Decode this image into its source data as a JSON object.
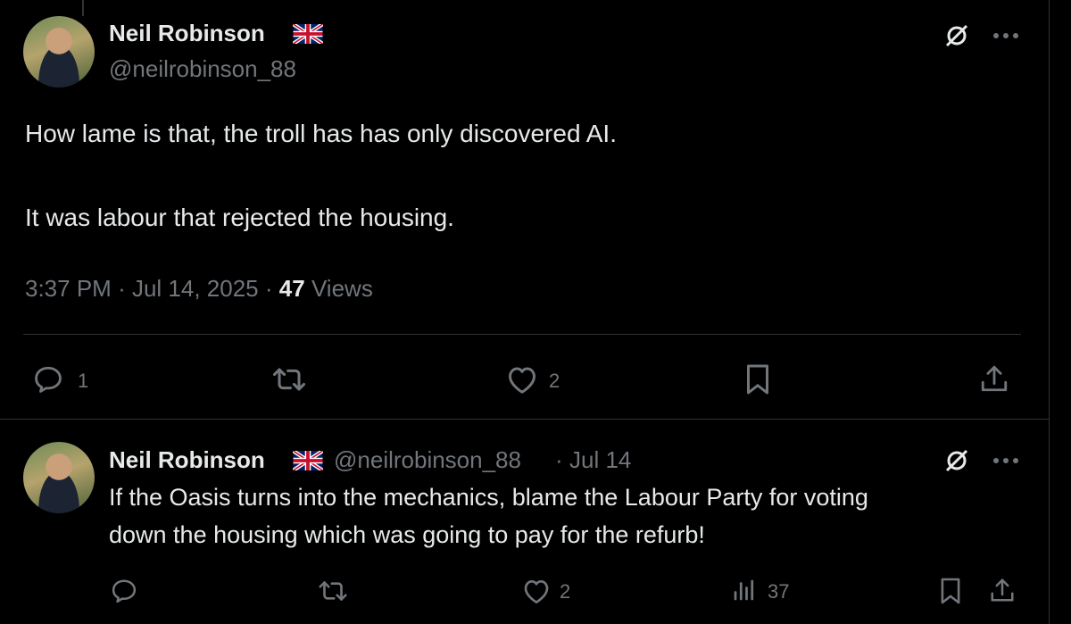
{
  "main_tweet": {
    "author_name": "Neil Robinson",
    "handle": "@neilrobinson_88",
    "text_line1": "How lame is that, the troll has has only discovered AI.",
    "text_line2": "It was labour that rejected the housing.",
    "time": "3:37 PM",
    "date": "Jul 14, 2025",
    "views_count": "47",
    "views_label": "Views",
    "replies": "1",
    "likes": "2"
  },
  "reply_tweet": {
    "author_name": "Neil Robinson",
    "handle": "@neilrobinson_88",
    "date": "Jul 14",
    "text_line1": "If the Oasis turns into the mechanics, blame the Labour Party for voting",
    "text_line2": "down the housing which was going to pay for the refurb!",
    "likes": "2",
    "views": "37"
  },
  "separator": "·",
  "icons": {
    "flag": "uk-flag-icon",
    "grok": "grok-icon",
    "more": "more-icon",
    "reply": "reply-icon",
    "repost": "repost-icon",
    "like": "like-icon",
    "bookmark": "bookmark-icon",
    "share": "share-icon",
    "views": "views-icon"
  },
  "colors": {
    "background": "#000000",
    "text": "#e7e9ea",
    "secondary": "#71767b",
    "border": "#2f3336"
  }
}
